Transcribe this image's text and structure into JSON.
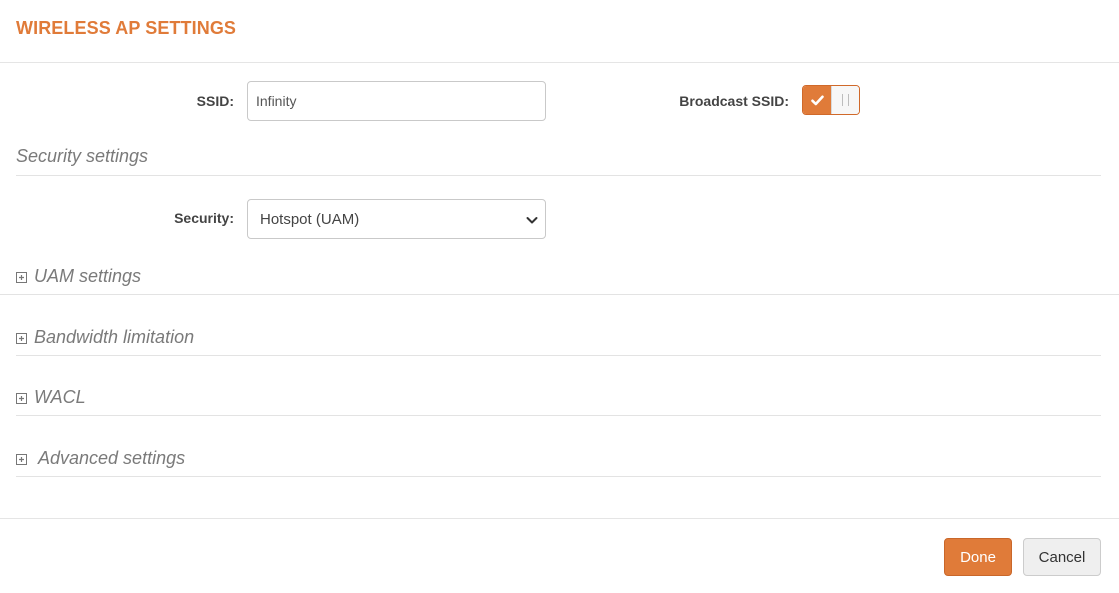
{
  "header": {
    "title": "WIRELESS AP SETTINGS"
  },
  "ssid": {
    "label": "SSID:",
    "value": "Infinity"
  },
  "broadcast": {
    "label": "Broadcast SSID:",
    "enabled": true,
    "on_icon": "check-icon"
  },
  "security_section": {
    "heading": "Security settings",
    "security_label": "Security:",
    "security_selected": "Hotspot (UAM)"
  },
  "collapsibles": [
    {
      "label": "UAM settings",
      "icon": "plus-square-icon",
      "expanded": false
    },
    {
      "label": "Bandwidth limitation",
      "icon": "plus-square-icon",
      "expanded": false
    },
    {
      "label": "WACL",
      "icon": "plus-square-icon",
      "expanded": false
    },
    {
      "label": "Advanced settings",
      "icon": "plus-square-icon",
      "expanded": false
    }
  ],
  "footer": {
    "done_label": "Done",
    "cancel_label": "Cancel"
  },
  "colors": {
    "accent": "#e07b39",
    "muted_text": "#7a7a7a",
    "divider": "#e3e3e3"
  }
}
